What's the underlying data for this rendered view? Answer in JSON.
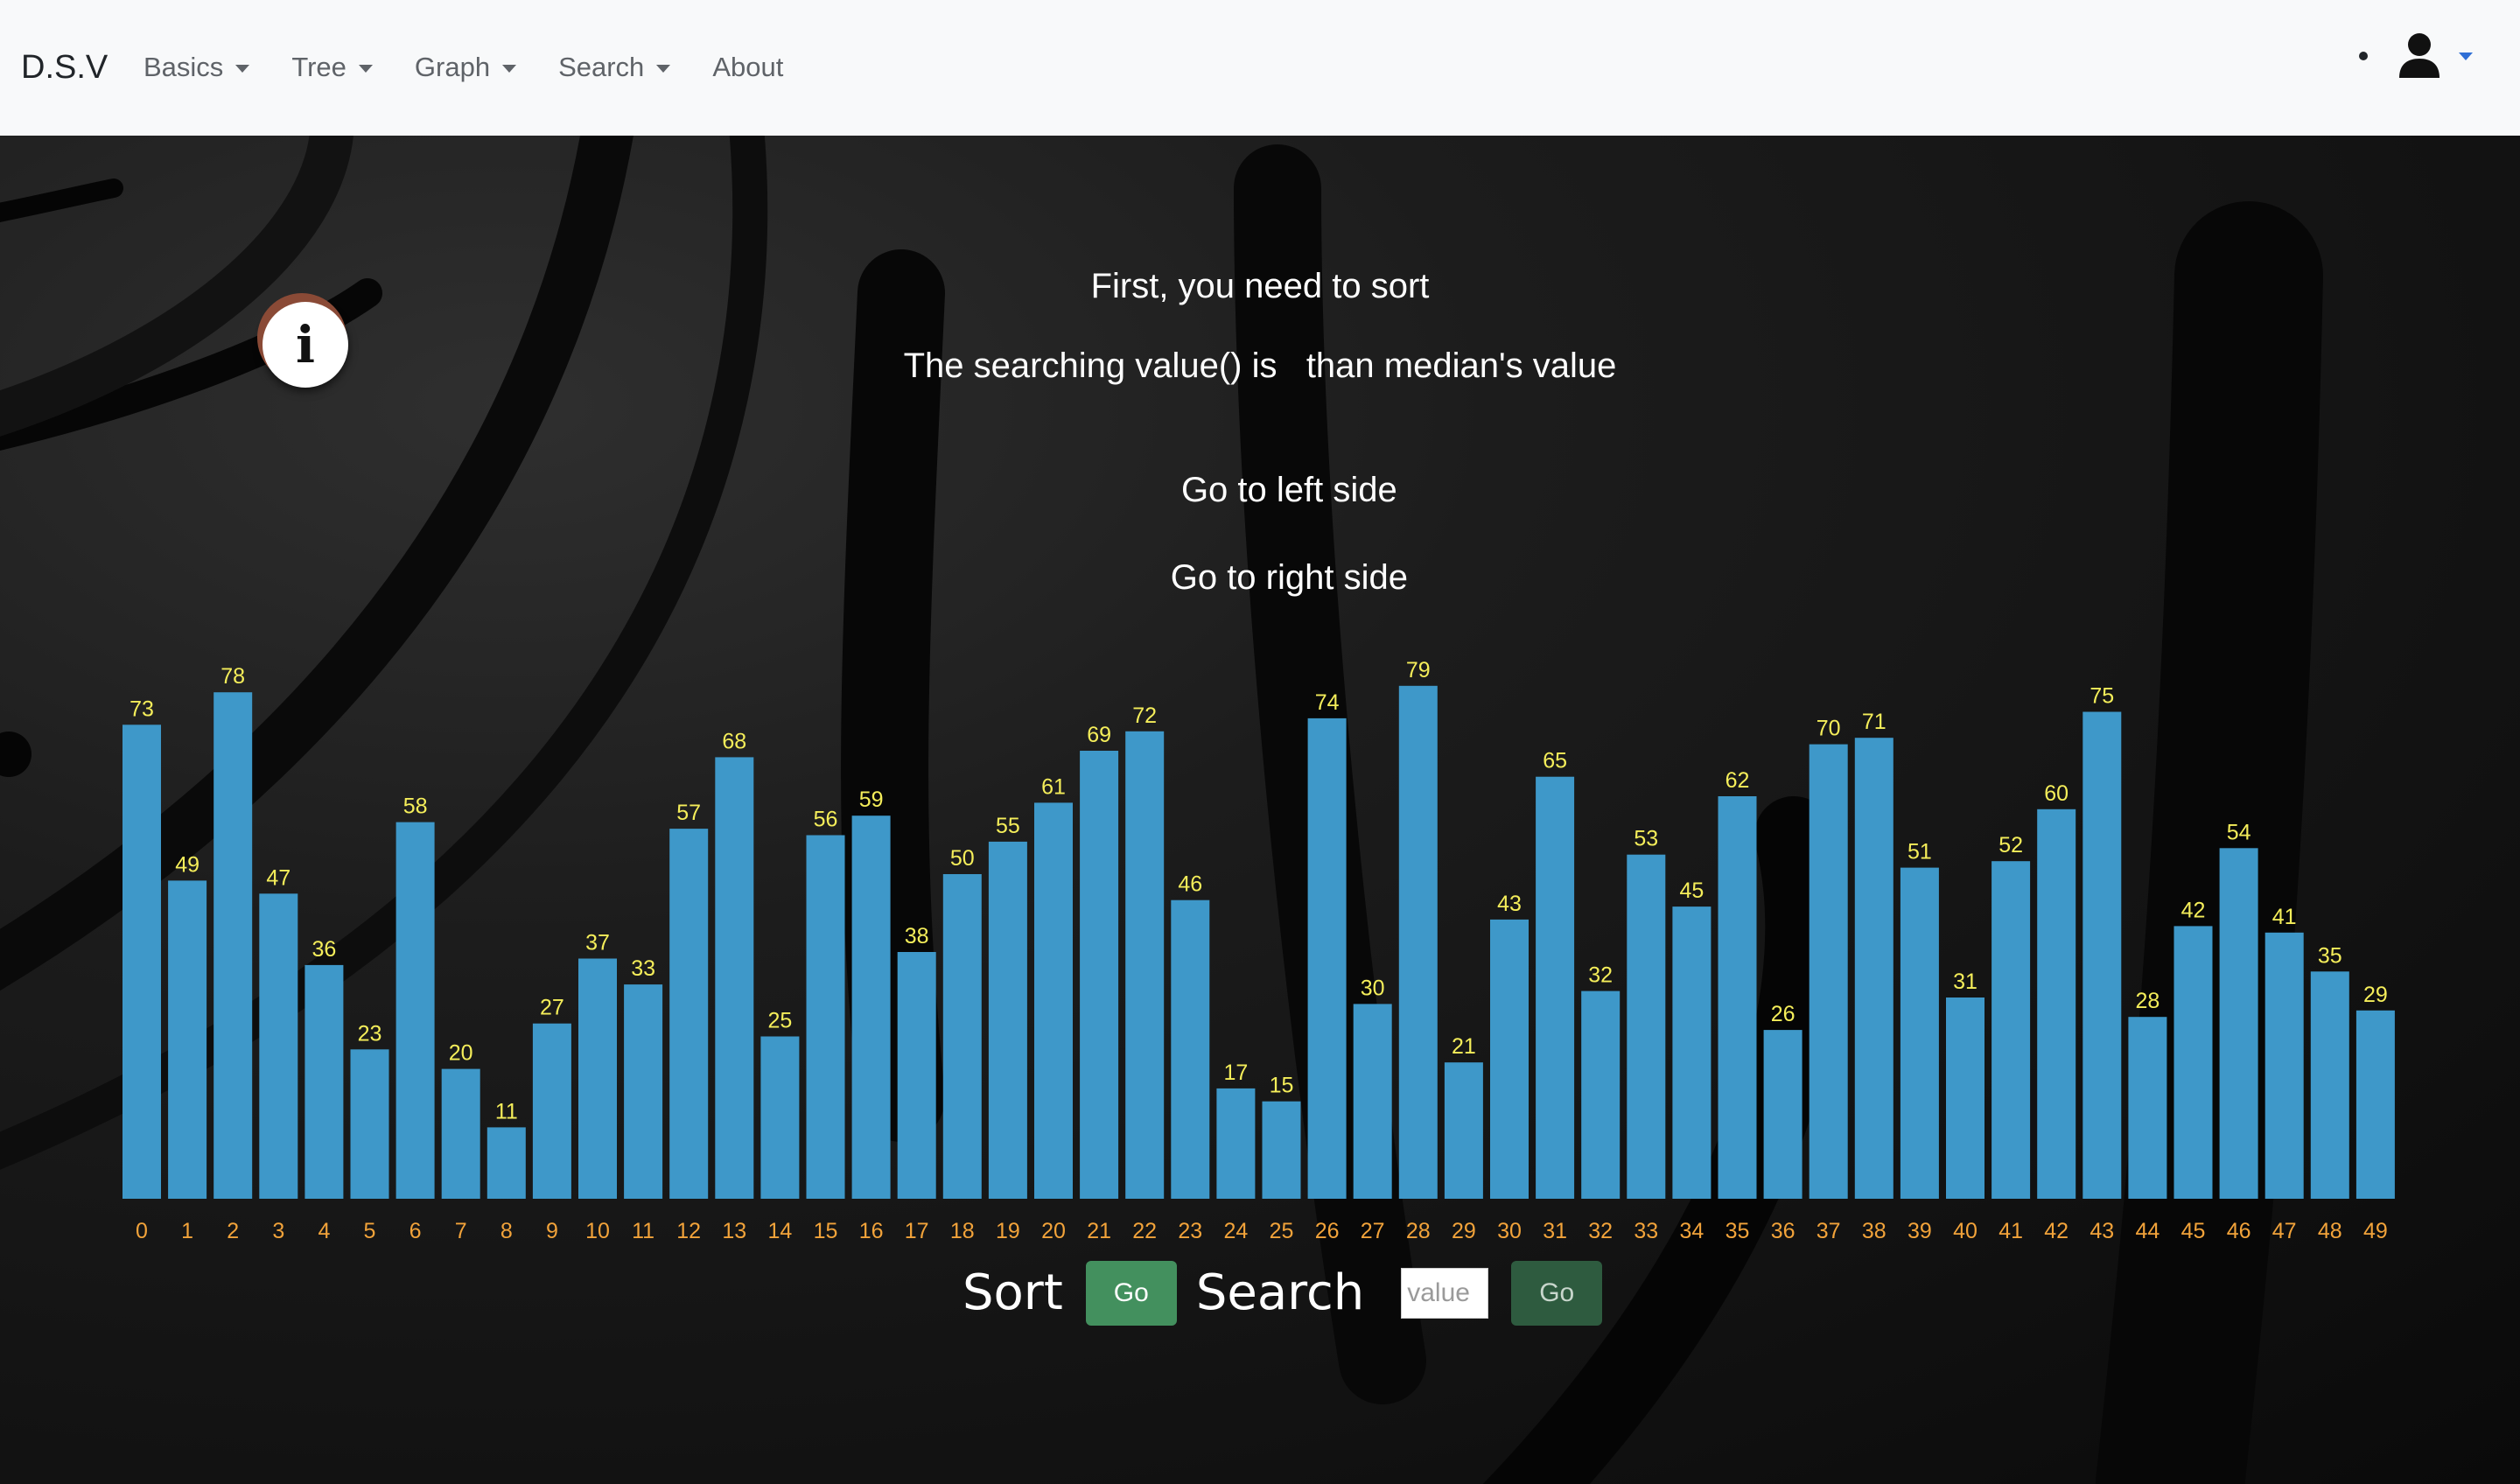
{
  "navbar": {
    "brand": "D.S.V",
    "items": [
      {
        "label": "Basics",
        "dropdown": true
      },
      {
        "label": "Tree",
        "dropdown": true
      },
      {
        "label": "Graph",
        "dropdown": true
      },
      {
        "label": "Search",
        "dropdown": true
      },
      {
        "label": "About",
        "dropdown": false
      }
    ],
    "user_icon": "user-icon"
  },
  "info_button": {
    "icon": "info-icon",
    "glyph": "i"
  },
  "messages": {
    "line1": "First, you need to sort",
    "line2": "The searching value() is   than median's value",
    "line3_left": "Go to left side",
    "line3_right": "Go to right side"
  },
  "controls": {
    "sort_label": "Sort",
    "sort_go": "Go",
    "search_label": "Search",
    "search_placeholder": "value",
    "search_go": "Go"
  },
  "colors": {
    "bar": "#3e98c9",
    "value_label": "#f5ee5a",
    "index_label": "#f2a33a",
    "navbar_bg": "#f8f9fa"
  },
  "chart_data": {
    "type": "bar",
    "categories": [
      "0",
      "1",
      "2",
      "3",
      "4",
      "5",
      "6",
      "7",
      "8",
      "9",
      "10",
      "11",
      "12",
      "13",
      "14",
      "15",
      "16",
      "17",
      "18",
      "19",
      "20",
      "21",
      "22",
      "23",
      "24",
      "25",
      "26",
      "27",
      "28",
      "29",
      "30",
      "31",
      "32",
      "33",
      "34",
      "35",
      "36",
      "37",
      "38",
      "39",
      "40",
      "41",
      "42",
      "43",
      "44",
      "45",
      "46",
      "47",
      "48",
      "49"
    ],
    "values": [
      73,
      49,
      78,
      47,
      36,
      23,
      58,
      20,
      11,
      27,
      37,
      33,
      57,
      68,
      25,
      56,
      59,
      38,
      50,
      55,
      61,
      69,
      72,
      46,
      17,
      15,
      74,
      30,
      79,
      21,
      43,
      65,
      32,
      53,
      45,
      62,
      26,
      70,
      71,
      51,
      31,
      52,
      60,
      75,
      28,
      42,
      54,
      41,
      35,
      29
    ],
    "data_labels": true,
    "grid": false,
    "legend": false
  }
}
